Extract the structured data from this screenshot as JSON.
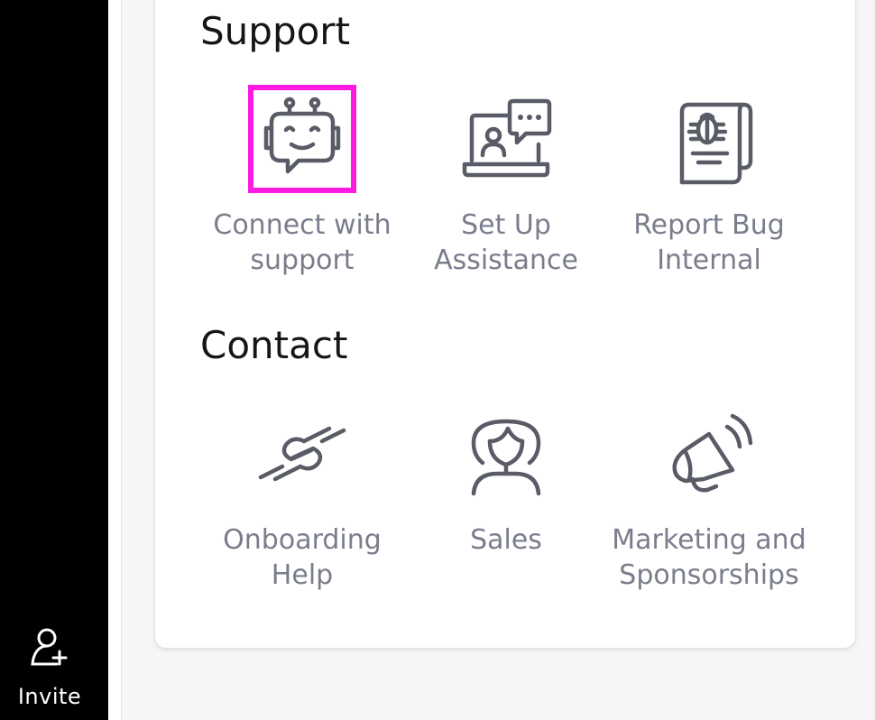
{
  "sidebar": {
    "invite_label": "Invite",
    "invite_icon": "add-user-icon"
  },
  "support": {
    "title": "Support",
    "items": [
      {
        "label": "Connect with\nsupport",
        "icon": "robot-chat-icon"
      },
      {
        "label": "Set Up\nAssistance",
        "icon": "video-call-icon"
      },
      {
        "label": "Report Bug\nInternal",
        "icon": "bug-report-icon"
      }
    ]
  },
  "contact": {
    "title": "Contact",
    "items": [
      {
        "label": "Onboarding\nHelp",
        "icon": "handshake-icon"
      },
      {
        "label": "Sales",
        "icon": "person-icon"
      },
      {
        "label": "Marketing and\nSponsorships",
        "icon": "megaphone-icon"
      }
    ]
  },
  "colors": {
    "highlight": "#ff19e1",
    "sidebar": "#000000",
    "icon": "#595c66",
    "label": "#7a7d8c"
  }
}
